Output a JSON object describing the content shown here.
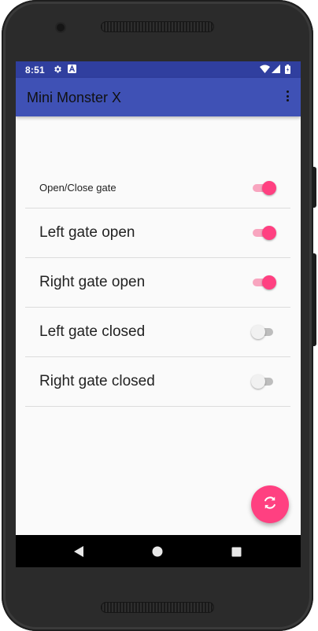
{
  "status_bar": {
    "time": "8:51",
    "background": "#303f9f",
    "icons": [
      "settings-gear-icon",
      "a-notification-icon",
      "wifi-icon",
      "signal-icon",
      "battery-icon"
    ]
  },
  "app_bar": {
    "title": "Mini Monster X",
    "background": "#3f51b5",
    "menu_icon": "overflow-menu-icon"
  },
  "settings": [
    {
      "label": "Open/Close gate",
      "state": "on"
    },
    {
      "label": "Left gate open",
      "state": "on"
    },
    {
      "label": "Right gate open",
      "state": "on"
    },
    {
      "label": "Left gate closed",
      "state": "off"
    },
    {
      "label": "Right gate closed",
      "state": "off"
    }
  ],
  "fab": {
    "icon": "refresh-icon",
    "color": "#ff4081"
  },
  "nav_bar": {
    "buttons": [
      "back-icon",
      "home-icon",
      "recents-icon"
    ]
  },
  "accent_color": "#ff4081"
}
